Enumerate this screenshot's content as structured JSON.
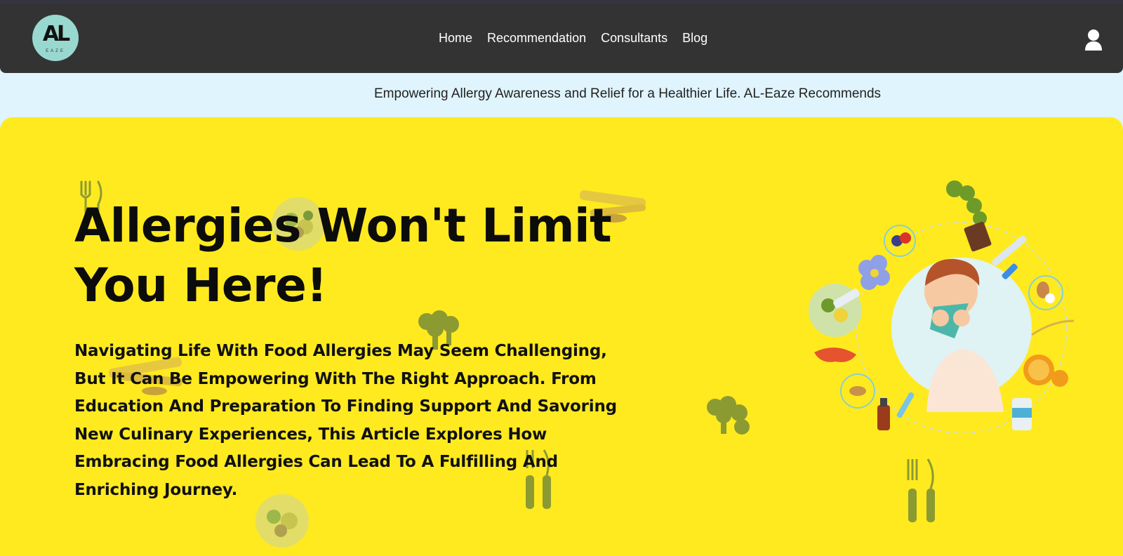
{
  "brand": {
    "logo_letters": "AL",
    "logo_sub": "EAZE"
  },
  "nav": {
    "items": [
      {
        "label": "Home"
      },
      {
        "label": "Recommendation"
      },
      {
        "label": "Consultants"
      },
      {
        "label": "Blog"
      }
    ],
    "account_icon": "user-icon"
  },
  "tagline": "Empowering Allergy Awareness and Relief for a Healthier Life. AL-Eaze Recommends",
  "hero": {
    "headline": "Allergies Won't Limit You Here!",
    "description": "Navigating Life With Food Allergies May Seem Challenging, But It Can Be Empowering With The Right Approach. From Education And Preparation To Finding Support And Savoring New Culinary Experiences, This Article Explores How Embracing Food Allergies Can Lead To A Fulfilling And Enriching Journey.",
    "illustration": "sneezing-person-with-allergens-illustration"
  },
  "colors": {
    "navbar": "#333333",
    "page_bg": "#e0f4fd",
    "hero_bg": "#ffea20",
    "logo_bg": "#98d8cf",
    "decoration_olive": "#8c9a32"
  }
}
